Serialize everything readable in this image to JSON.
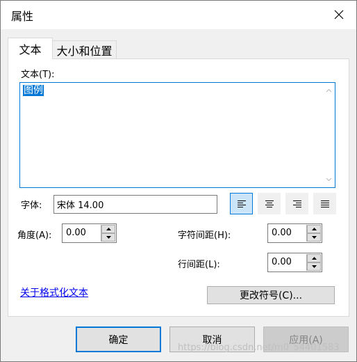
{
  "window": {
    "title": "属性",
    "close_icon": "close-icon"
  },
  "tabs": [
    {
      "label": "文本",
      "active": true
    },
    {
      "label": "大小和位置",
      "active": false
    }
  ],
  "text_section": {
    "label": "文本(T):",
    "content": "图例"
  },
  "font": {
    "label": "字体:",
    "value": "宋体 14.00"
  },
  "alignment": {
    "buttons": [
      {
        "name": "align-left",
        "icon": "align-left-icon",
        "active": true
      },
      {
        "name": "align-center",
        "icon": "align-center-icon",
        "active": false
      },
      {
        "name": "align-right",
        "icon": "align-right-icon",
        "active": false
      },
      {
        "name": "align-justify",
        "icon": "align-justify-icon",
        "active": false
      }
    ]
  },
  "angle": {
    "label": "角度(A):",
    "value": "0.00"
  },
  "char_spacing": {
    "label": "字符间距(H):",
    "value": "0.00"
  },
  "line_spacing": {
    "label": "行间距(L):",
    "value": "0.00"
  },
  "format_link": "关于格式化文本",
  "change_symbol_button": "更改符号(C)...",
  "footer": {
    "ok": "确定",
    "cancel": "取消",
    "apply": "应用(A)"
  },
  "watermark": "https://blog.csdn.net/m0_54401583",
  "colors": {
    "accent": "#0078d7",
    "link": "#0000ee",
    "panel": "#ffffff",
    "background": "#f0f0f0"
  }
}
